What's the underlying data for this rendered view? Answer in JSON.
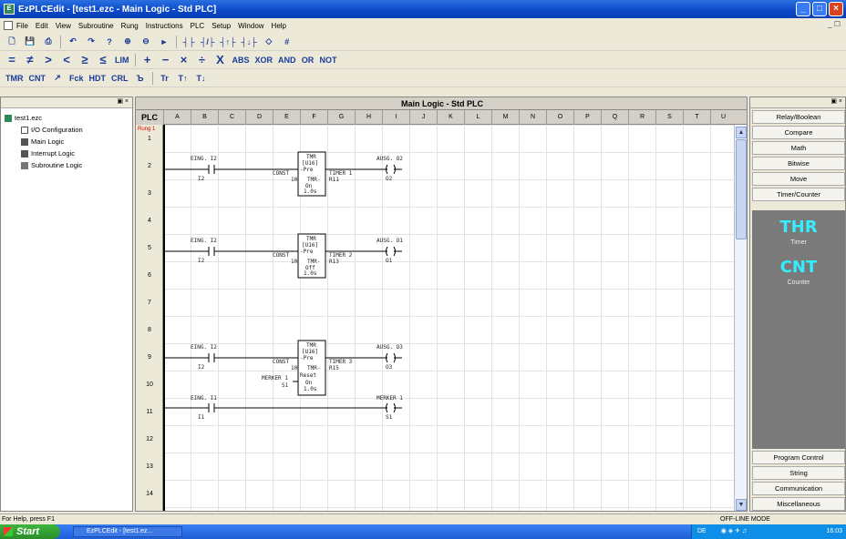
{
  "window": {
    "title": "EzPLCEdit - [test1.ezc - Main Logic - Std PLC]",
    "controls": [
      "minimize-icon",
      "maximize-icon",
      "close-icon"
    ]
  },
  "menubar": {
    "items": [
      "File",
      "Edit",
      "View",
      "Subroutine",
      "Rung",
      "Instructions",
      "PLC",
      "Setup",
      "Window",
      "Help"
    ]
  },
  "toolbar1": {
    "items": [
      "↶",
      "↷",
      "?",
      "⊕",
      "⊖",
      "►",
      "┤├",
      "┤/├",
      "┤↑├",
      "┤↓├",
      "◇",
      "#"
    ]
  },
  "toolbar2": {
    "items": [
      "=",
      "≠",
      ">",
      "<",
      "≥",
      "≤",
      "LIM",
      "+",
      "−",
      "×",
      "÷",
      "X",
      "ABS",
      "XOR",
      "AND",
      "OR",
      "NOT"
    ]
  },
  "toolbar3": {
    "items": [
      "TMR",
      "CNT",
      "↗",
      "Fck",
      "HDT",
      "CRL",
      "Ъ",
      "Tr",
      "T↑",
      "T↓"
    ]
  },
  "project": {
    "root": "test1.ezc",
    "items": [
      "I/O Configuration",
      "Main Logic",
      "Interrupt Logic",
      "Subroutine Logic"
    ]
  },
  "ladder": {
    "header": "Main Logic - Std PLC",
    "plc_label": "PLC",
    "columns": [
      "A",
      "B",
      "C",
      "D",
      "E",
      "F",
      "G",
      "H",
      "I",
      "J",
      "K",
      "L",
      "M",
      "N",
      "O",
      "P",
      "Q",
      "R",
      "S",
      "T",
      "U"
    ],
    "rung_tag": "Rung 1",
    "rungs": [
      "1",
      "2",
      "3",
      "4",
      "5",
      "6",
      "7",
      "8",
      "9",
      "10",
      "11",
      "12",
      "13",
      "14"
    ],
    "elements": {
      "r2_contact_label": "EING. I2",
      "r2_contact_addr": "I2",
      "r2_tmr_title": "TMR",
      "r2_tmr_sub": "[U16]",
      "r2_pre": "-Pre",
      "r2_const": "CONST",
      "r2_const_val": "10",
      "r2_tmr_out": "TMR-",
      "r2_timer_name": "TIMER 1",
      "r2_timer_reg": "R11",
      "r2_mode": "On",
      "r2_base": "1.0s",
      "r2_coil_label": "AUSG. O2",
      "r2_coil_addr": "O2",
      "r5_contact_label": "EING. I2",
      "r5_contact_addr": "I2",
      "r5_tmr_title": "TMR",
      "r5_tmr_sub": "[U16]",
      "r5_pre": "-Pre",
      "r5_const": "CONST",
      "r5_const_val": "10",
      "r5_tmr_out": "TMR-",
      "r5_timer_name": "TIMER 2",
      "r5_timer_reg": "R13",
      "r5_mode": "Off",
      "r5_base": "1.0s",
      "r5_coil_label": "AUSG. O1",
      "r5_coil_addr": "O1",
      "r9_contact_label": "EING. I2",
      "r9_contact_addr": "I2",
      "r9_tmr_title": "TMR",
      "r9_tmr_sub": "[U16]",
      "r9_pre": "-Pre",
      "r9_const": "CONST",
      "r9_const_val": "10",
      "r9_tmr_out": "TMR-",
      "r9_timer_name": "TIMER 3",
      "r9_timer_reg": "R15",
      "r9_reset": "Reset",
      "r9_merker": "MERKER 1",
      "r9_merker_addr": "S1",
      "r9_mode": "On",
      "r9_base": "1.0s",
      "r9_coil_label": "AUSG. O3",
      "r9_coil_addr": "O3",
      "r11_contact_label": "EING. I1",
      "r11_contact_addr": "I1",
      "r11_coil_label": "MERKER 1",
      "r11_coil_addr": "S1"
    }
  },
  "instructions": {
    "top_buttons": [
      "Relay/Boolean",
      "Compare",
      "Math",
      "Bitwise",
      "Move",
      "Timer/Counter"
    ],
    "panel_items": [
      {
        "icon": "THR",
        "label": "Timer"
      },
      {
        "icon": "CNT",
        "label": "Counter"
      }
    ],
    "bottom_buttons": [
      "Program Control",
      "String",
      "Communication",
      "Miscellaneous"
    ]
  },
  "status": {
    "help": "For Help, press F1",
    "mode": "OFF-LINE MODE"
  },
  "taskbar": {
    "start": "Start",
    "task": "EzPLCEdit - [test1.ez...",
    "tray_lang": "DE",
    "clock": "16:03"
  }
}
